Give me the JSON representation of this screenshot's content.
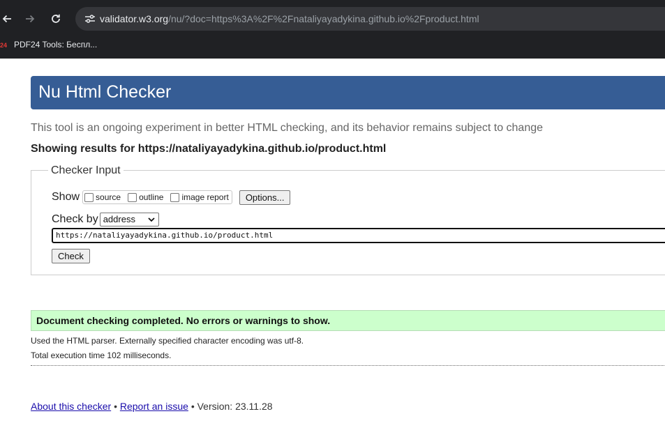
{
  "browser": {
    "url_host": "validator.w3.org",
    "url_rest": "/nu/?doc=https%3A%2F%2Fnataliyayadykina.github.io%2Fproduct.html",
    "bookmark": {
      "icon_text": "24",
      "label": "PDF24 Tools: Беспл..."
    },
    "icons": [
      "back-arrow-icon",
      "forward-arrow-icon",
      "reload-icon",
      "site-info-icon"
    ]
  },
  "header": {
    "title": "Nu Html Checker"
  },
  "intro": {
    "lead": "This tool is an ongoing experiment in better HTML checking, and its behavior remains subject to change",
    "showing_results": "Showing results for https://nataliyayadykina.github.io/product.html"
  },
  "checker_input": {
    "legend": "Checker Input",
    "show_label": "Show",
    "options": [
      {
        "label": "source",
        "checked": false
      },
      {
        "label": "outline",
        "checked": false
      },
      {
        "label": "image report",
        "checked": false
      }
    ],
    "options_button": "Options...",
    "check_by_label": "Check by",
    "check_by_value": "address",
    "url_value": "https://nataliyayadykina.github.io/product.html",
    "check_button": "Check"
  },
  "result": {
    "message": "Document checking completed. No errors or warnings to show.",
    "details": [
      "Used the HTML parser. Externally specified character encoding was utf-8.",
      "Total execution time 102 milliseconds."
    ]
  },
  "footer": {
    "about_link": "About this checker",
    "separator": "•",
    "report_link": "Report an issue",
    "version": "Version: 23.11.28"
  },
  "colors": {
    "chrome_bg": "#202124",
    "banner_bg": "#365d95",
    "success_bg": "#ccffcc",
    "link": "#1a0dab"
  }
}
